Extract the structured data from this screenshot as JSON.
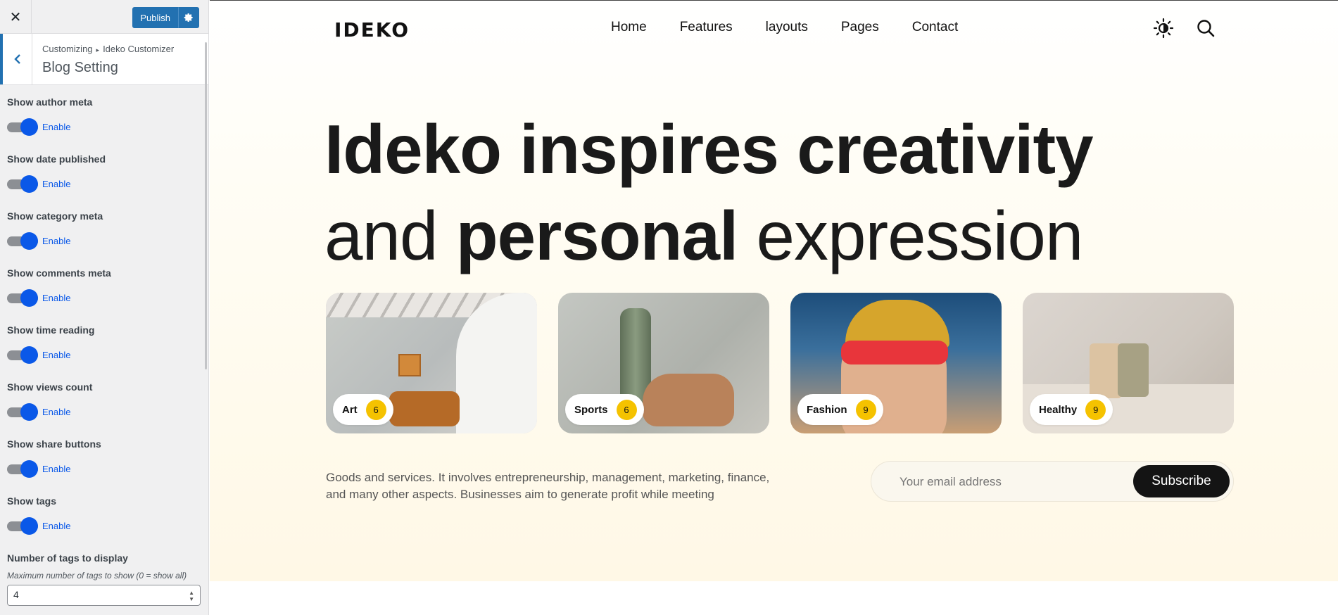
{
  "customizer": {
    "close_icon": "close-icon",
    "publish_label": "Publish",
    "gear_icon": "gear-icon",
    "breadcrumb": [
      "Customizing",
      "Ideko Customizer"
    ],
    "breadcrumb_sep": "▸",
    "section_title": "Blog Setting",
    "toggles": [
      {
        "label": "Show author meta",
        "state": "Enable"
      },
      {
        "label": "Show date published",
        "state": "Enable"
      },
      {
        "label": "Show category meta",
        "state": "Enable"
      },
      {
        "label": "Show comments meta",
        "state": "Enable"
      },
      {
        "label": "Show time reading",
        "state": "Enable"
      },
      {
        "label": "Show views count",
        "state": "Enable"
      },
      {
        "label": "Show share buttons",
        "state": "Enable"
      },
      {
        "label": "Show tags",
        "state": "Enable"
      }
    ],
    "tags_number": {
      "label": "Number of tags to display",
      "description": "Maximum number of tags to show (0 = show all)",
      "value": "4"
    },
    "accent_color": "#2271b1",
    "toggle_color": "#0a58e8"
  },
  "site": {
    "logo": "IDEKO",
    "menu": [
      "Home",
      "Features",
      "layouts",
      "Pages",
      "Contact"
    ],
    "headline": {
      "line1": "Ideko inspires creativity",
      "line2_pre": "and ",
      "line2_bold": "personal",
      "line2_post": " expression"
    },
    "cards": [
      {
        "label": "Art",
        "count": "6"
      },
      {
        "label": "Sports",
        "count": "6"
      },
      {
        "label": "Fashion",
        "count": "9"
      },
      {
        "label": "Healthy",
        "count": "9"
      }
    ],
    "description": "Goods and services. It involves entrepreneurship, management, marketing, finance, and many other aspects. Businesses aim to generate profit while meeting",
    "email_placeholder": "Your email address",
    "subscribe_label": "Subscribe",
    "badge_color": "#f5c200"
  }
}
